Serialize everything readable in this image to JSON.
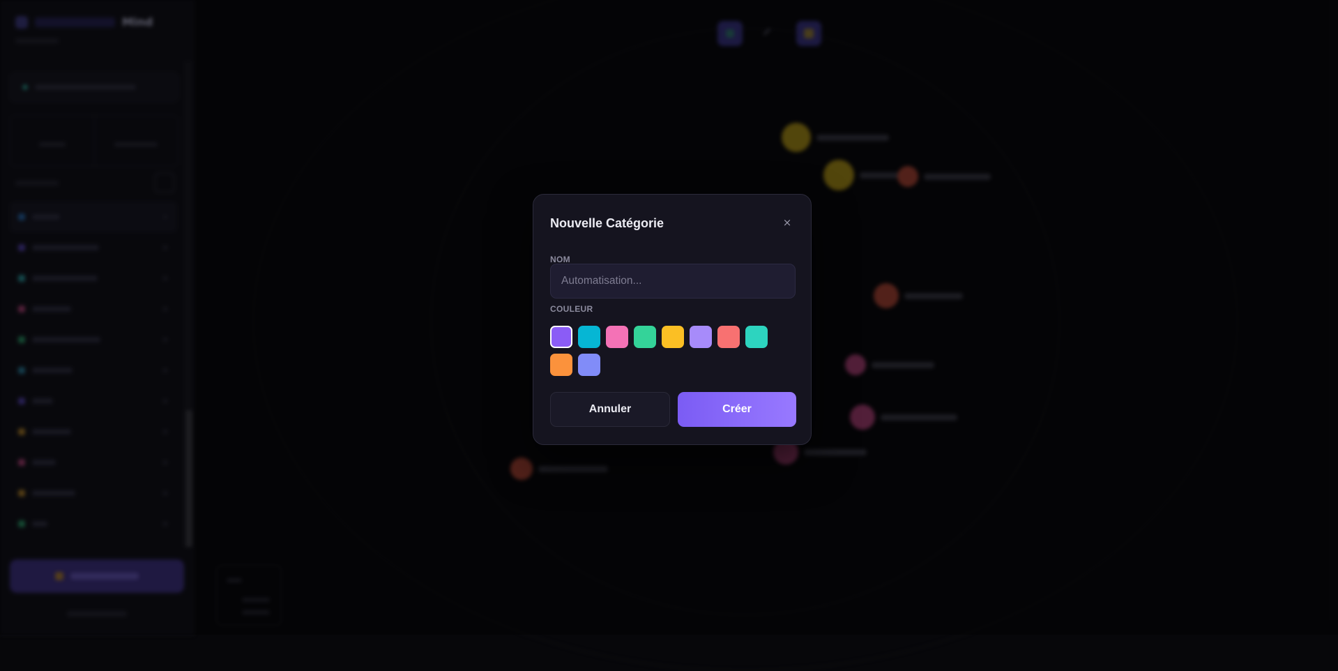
{
  "dialog": {
    "title": "Nouvelle Catégorie",
    "close_glyph": "×",
    "name_label": "NOM",
    "name_value": "",
    "name_placeholder": "Automatisation...",
    "color_label": "COULEUR",
    "colors": [
      "#8b5cf6",
      "#06b6d4",
      "#f472b6",
      "#34d399",
      "#fbbf24",
      "#a78bfa",
      "#f87171",
      "#2dd4bf",
      "#fb923c",
      "#818cf8"
    ],
    "selected_color": "#8b5cf6",
    "cancel_label": "Annuler",
    "create_label": "Créer"
  },
  "background": {
    "brand_name": "Mind",
    "stats": [
      {
        "value": "",
        "color": "#3b3575"
      },
      {
        "value": "",
        "color": "#3b3575"
      }
    ],
    "category_colors": [
      "#1e4a7a",
      "#3b2f7a",
      "#1f6b70",
      "#7a2f55",
      "#1f6b4a",
      "#1f5a70",
      "#3b2f7a",
      "#7a5a1f",
      "#7a2f55",
      "#7a5a1f",
      "#1f6b4a"
    ],
    "node_colors": {
      "yellow": "#7a6712",
      "red": "#7a3227",
      "pink": "#7a2f55"
    }
  }
}
